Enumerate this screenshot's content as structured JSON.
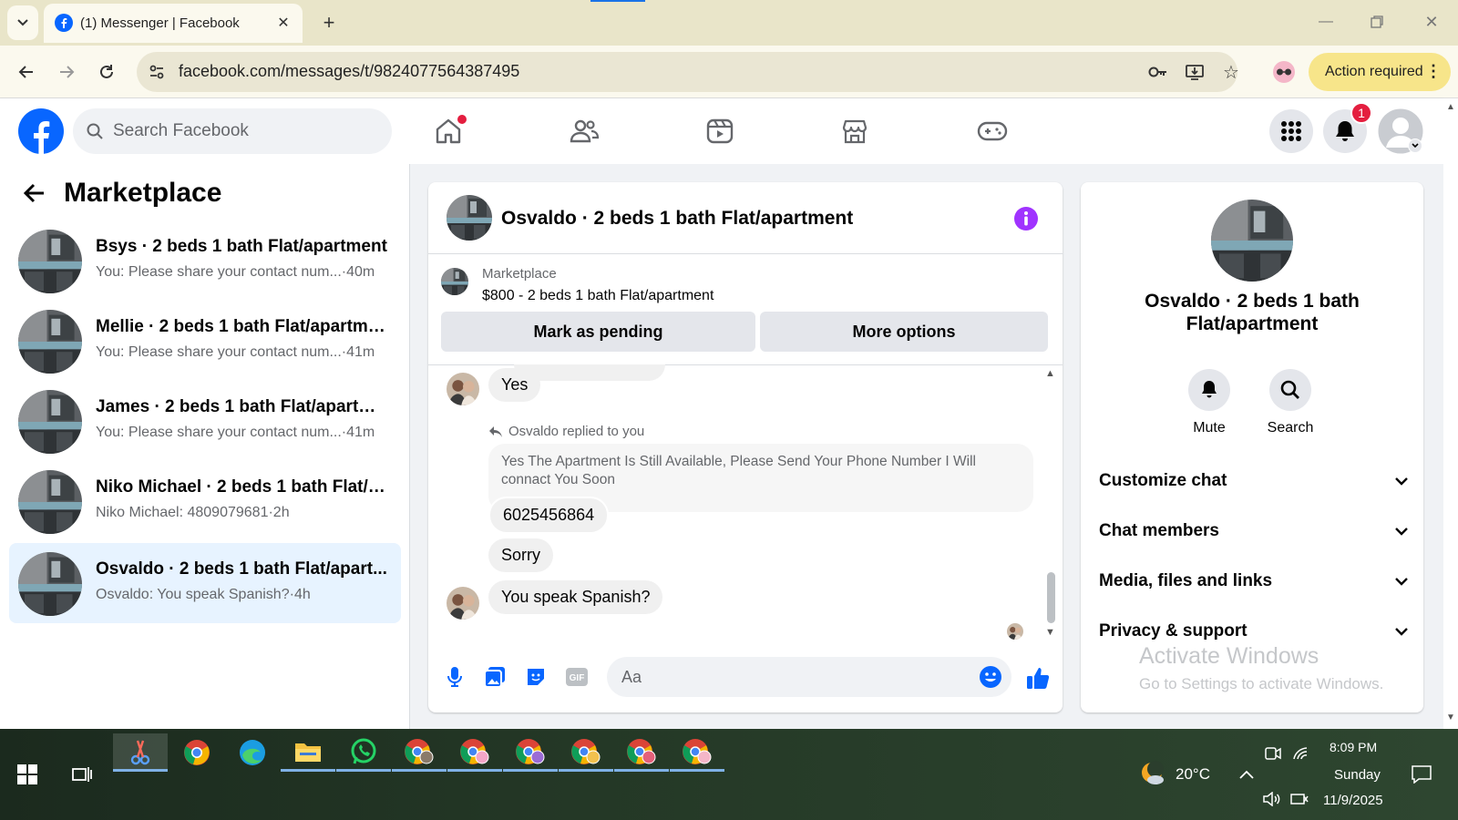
{
  "browser": {
    "tab_title": "(1) Messenger | Facebook",
    "url": "facebook.com/messages/t/9824077564387495",
    "action_required": "Action required"
  },
  "fb": {
    "search_placeholder": "Search Facebook",
    "notification_count": "1"
  },
  "left": {
    "title": "Marketplace",
    "conversations": [
      {
        "title": "Bsys · 2 beds 1 bath Flat/apartment",
        "snippet": "You: Please share your contact num...",
        "time": "·40m"
      },
      {
        "title": "Mellie · 2 beds 1 bath Flat/apartme...",
        "snippet": "You: Please share your contact num...",
        "time": "·41m"
      },
      {
        "title": "James · 2 beds 1 bath Flat/apartme...",
        "snippet": "You: Please share your contact num...",
        "time": "·41m"
      },
      {
        "title": "Niko Michael · 2 beds 1 bath Flat/a...",
        "snippet": "Niko Michael: 4809079681",
        "time": "·2h"
      },
      {
        "title": "Osvaldo · 2 beds 1 bath Flat/apart...",
        "snippet": "Osvaldo: You speak Spanish?",
        "time": "·4h"
      }
    ]
  },
  "chat": {
    "title": "Osvaldo · 2 beds 1 bath Flat/apartment",
    "listing_source": "Marketplace",
    "listing": "$800 - 2 beds 1 bath Flat/apartment",
    "mark_pending": "Mark as pending",
    "more_options": "More options",
    "messages": {
      "yes": "Yes",
      "reply_label": "Osvaldo replied to you",
      "quoted": "Yes The Apartment Is Still Available, Please Send Your Phone Number I Will connact You Soon",
      "phone": "6025456864",
      "sorry": "Sorry",
      "spanish": "You speak Spanish?"
    },
    "composer_placeholder": "Aa"
  },
  "right": {
    "name": "Osvaldo · 2 beds 1 bath Flat/apartment",
    "mute": "Mute",
    "search": "Search",
    "sections": [
      "Customize chat",
      "Chat members",
      "Media, files and links",
      "Privacy & support"
    ]
  },
  "watermark": {
    "line1": "Activate Windows",
    "line2": "Go to Settings to activate Windows."
  },
  "taskbar": {
    "weather": "20°C",
    "time": "8:09 PM",
    "day": "Sunday",
    "date": "11/9/2025"
  },
  "colors": {
    "fb_blue": "#0866ff",
    "accent_purple": "#a033ff",
    "selected_bg": "#e7f3ff",
    "action_yellow": "#f7e58a"
  }
}
